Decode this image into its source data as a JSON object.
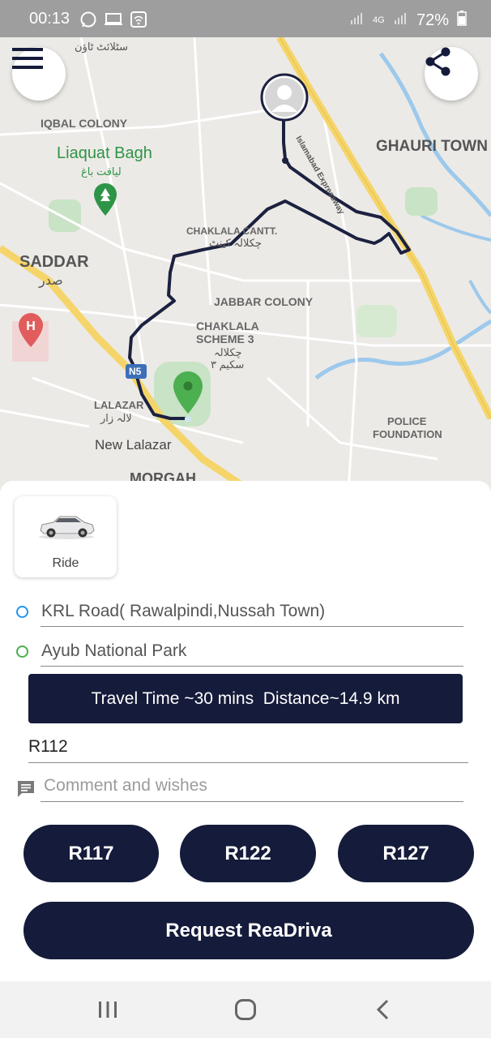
{
  "status_bar": {
    "time": "00:13",
    "network": "4G",
    "battery": "72%"
  },
  "map": {
    "labels": {
      "top_urdu": "سٹلائٹ ٹاؤن",
      "iqbal_colony": "IQBAL COLONY",
      "liaquat_bagh": "Liaquat Bagh",
      "liaquat_bagh_urdu": "لیاقت باغ",
      "ghauri_town": "GHAURI TOWN",
      "chaklala_cantt": "CHAKLALA CANTT.",
      "chaklala_cantt_urdu": "چکلالہ کینٹ",
      "saddar": "SADDAR",
      "saddar_urdu": "صدر",
      "jabbar_colony": "JABBAR COLONY",
      "chaklala_scheme_1": "CHAKLALA",
      "chaklala_scheme_2": "SCHEME 3",
      "chaklala_scheme_urdu_1": "چکلالہ",
      "chaklala_scheme_urdu_2": "سکیم ۳",
      "lalazar": "LALAZAR",
      "lalazar_urdu": "لالہ زار",
      "new_lalazar": "New Lalazar",
      "police_1": "POLICE",
      "police_2": "FOUNDATION",
      "morgah": "MORGAH",
      "expressway": "Islamabad Expressway",
      "n5": "N5"
    }
  },
  "vehicle": {
    "label": "Ride",
    "selected": true
  },
  "pickup": {
    "value": "KRL Road( Rawalpindi,Nussah Town)"
  },
  "dropoff": {
    "value": "Ayub National Park"
  },
  "trip_info": "Travel Time ~30 mins  Distance~14.9 km",
  "price": {
    "value": "R112"
  },
  "comment": {
    "placeholder": "Comment and wishes"
  },
  "fare_options": [
    "R117",
    "R122",
    "R127"
  ],
  "request_button": "Request ReaDriva",
  "colors": {
    "primary": "#151b3a",
    "route": "#1c2140",
    "pickup_dot": "#2196f3",
    "dropoff_dot": "#4caf50"
  }
}
